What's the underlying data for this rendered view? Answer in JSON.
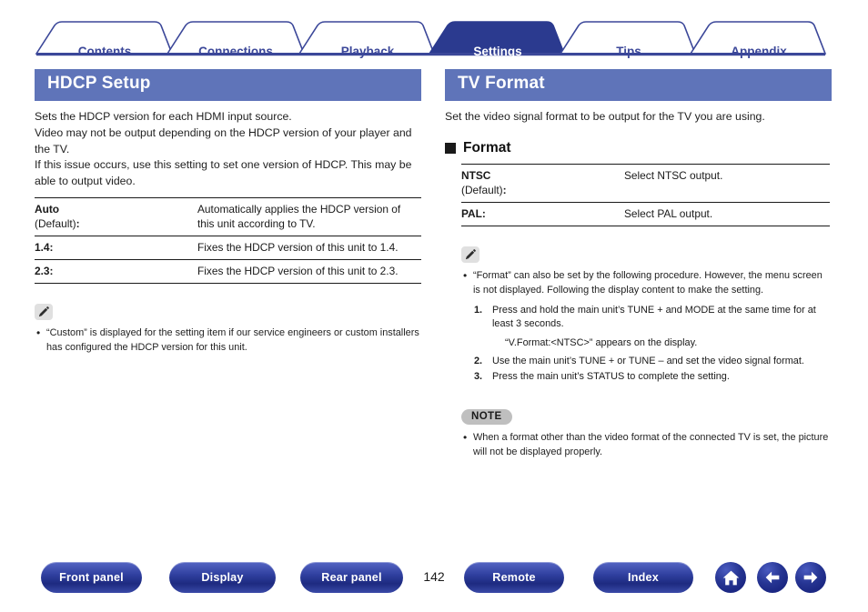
{
  "tabs": [
    {
      "label": "Contents",
      "active": false
    },
    {
      "label": "Connections",
      "active": false
    },
    {
      "label": "Playback",
      "active": false
    },
    {
      "label": "Settings",
      "active": true
    },
    {
      "label": "Tips",
      "active": false
    },
    {
      "label": "Appendix",
      "active": false
    }
  ],
  "left": {
    "title": "HDCP Setup",
    "intro": [
      "Sets the HDCP version for each HDMI input source.",
      "Video may not be output depending on the HDCP version of your player and the TV.",
      "If this issue occurs, use this setting to set one version of HDCP. This may be able to output video."
    ],
    "table": [
      {
        "key": "Auto",
        "key_sub": "(Default)",
        "value": "Automatically applies the HDCP version of this unit according to TV."
      },
      {
        "key": "1.4:",
        "key_sub": "",
        "value": "Fixes the HDCP version of this unit to 1.4."
      },
      {
        "key": "2.3:",
        "key_sub": "",
        "value": "Fixes the HDCP version of this unit to 2.3."
      }
    ],
    "tip_icon": "pencil-icon",
    "bullets": [
      "“Custom” is displayed for the setting item if our service engineers or custom installers has configured the HDCP version for this unit."
    ]
  },
  "right": {
    "title": "TV Format",
    "intro": [
      "Set the video signal format to be output for the TV you are using."
    ],
    "subhead": "Format",
    "table": [
      {
        "key": "NTSC",
        "key_sub": "(Default)",
        "value": "Select NTSC output."
      },
      {
        "key": "PAL:",
        "key_sub": "",
        "value": "Select PAL output."
      }
    ],
    "tip_icon": "pencil-icon",
    "bullets": [
      "“Format” can also be set by the following procedure. However, the menu screen is not displayed. Following the display content to make the setting."
    ],
    "steps": [
      {
        "num": "1.",
        "text": "Press and hold the main unit’s TUNE + and MODE at the same time for at least 3 seconds."
      },
      {
        "num": "2.",
        "text": "Use the main unit’s TUNE + or TUNE – and set the video signal format."
      },
      {
        "num": "3.",
        "text": "Press the main unit’s STATUS to complete the setting."
      }
    ],
    "substep": "“V.Format:<NTSC>” appears on the display.",
    "note_badge": "NOTE",
    "note_bullets": [
      "When a format other than the video format of the connected TV is set, the picture will not be displayed properly."
    ]
  },
  "footer": {
    "buttons": [
      {
        "label": "Front panel"
      },
      {
        "label": "Display"
      },
      {
        "label": "Rear panel"
      },
      {
        "label": "Remote"
      },
      {
        "label": "Index"
      }
    ],
    "page_number": "142",
    "icons": [
      "home-icon",
      "arrow-left-icon",
      "arrow-right-icon"
    ]
  },
  "colors": {
    "tab_active_bg": "#2b3a8f",
    "tab_border": "#3b4799",
    "section_header_bg": "#5f74b9",
    "footer_pill": "#2f3f9e"
  }
}
